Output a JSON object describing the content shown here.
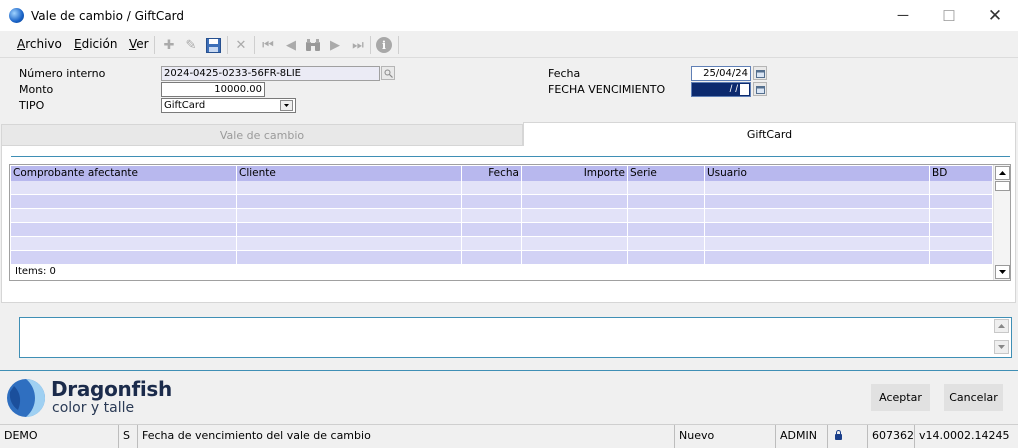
{
  "window": {
    "title": "Vale de cambio / GiftCard",
    "controls": {
      "minimize": "─",
      "maximize": "☐",
      "close": "✕"
    }
  },
  "menu": {
    "items": [
      {
        "accel": "A",
        "rest": "rchivo"
      },
      {
        "accel": "E",
        "rest": "dición"
      },
      {
        "accel": "V",
        "rest": "er"
      }
    ]
  },
  "toolbar": {
    "icons": [
      "plus-icon",
      "pencil-icon",
      "save-icon",
      "delete-icon",
      "first-record-icon",
      "previous-record-icon",
      "search-binoculars-icon",
      "next-record-icon",
      "last-record-icon",
      "info-icon"
    ],
    "glyphs": {
      "add": "✚",
      "edit": "✎",
      "delete": "✕",
      "first": "⏮",
      "prev": "◀",
      "find": "⚲",
      "next": "▶",
      "last": "⏭",
      "info": "i"
    }
  },
  "form": {
    "numero_interno_label": "Número interno",
    "numero_interno_value": "2024-0425-0233-56FR-8LIE",
    "monto_label": "Monto",
    "monto_value": "10000.00",
    "tipo_label": "TIPO",
    "tipo_value": "GiftCard",
    "fecha_label": "Fecha",
    "fecha_value": "25/04/24",
    "vencimiento_label": "FECHA VENCIMIENTO",
    "vencimiento_value": "/ /"
  },
  "tabs": [
    {
      "label": "Vale de cambio",
      "active": false
    },
    {
      "label": "GiftCard",
      "active": true
    }
  ],
  "grid": {
    "columns": [
      "Comprobante afectante",
      "Cliente",
      "Fecha",
      "Importe",
      "Serie",
      "Usuario",
      "BD"
    ],
    "rows": [],
    "items_label": "Items: 0"
  },
  "footer": {
    "brand_name": "Dragonfish",
    "brand_sub": "color y talle",
    "accept_label": "Aceptar",
    "cancel_label": "Cancelar"
  },
  "statusbar": {
    "db": "DEMO",
    "flag": "S",
    "message": "Fecha de vencimiento del vale de cambio",
    "mode": "Nuevo",
    "user": "ADMIN",
    "number": "607362",
    "version": "v14.0002.14245"
  },
  "colors": {
    "accent": "#3f8fb5",
    "grid_header": "#b8b8ee",
    "grid_row_a": "#e2e2f8",
    "grid_row_b": "#d2d2f5",
    "date_field_active": "#0c2a6e"
  }
}
